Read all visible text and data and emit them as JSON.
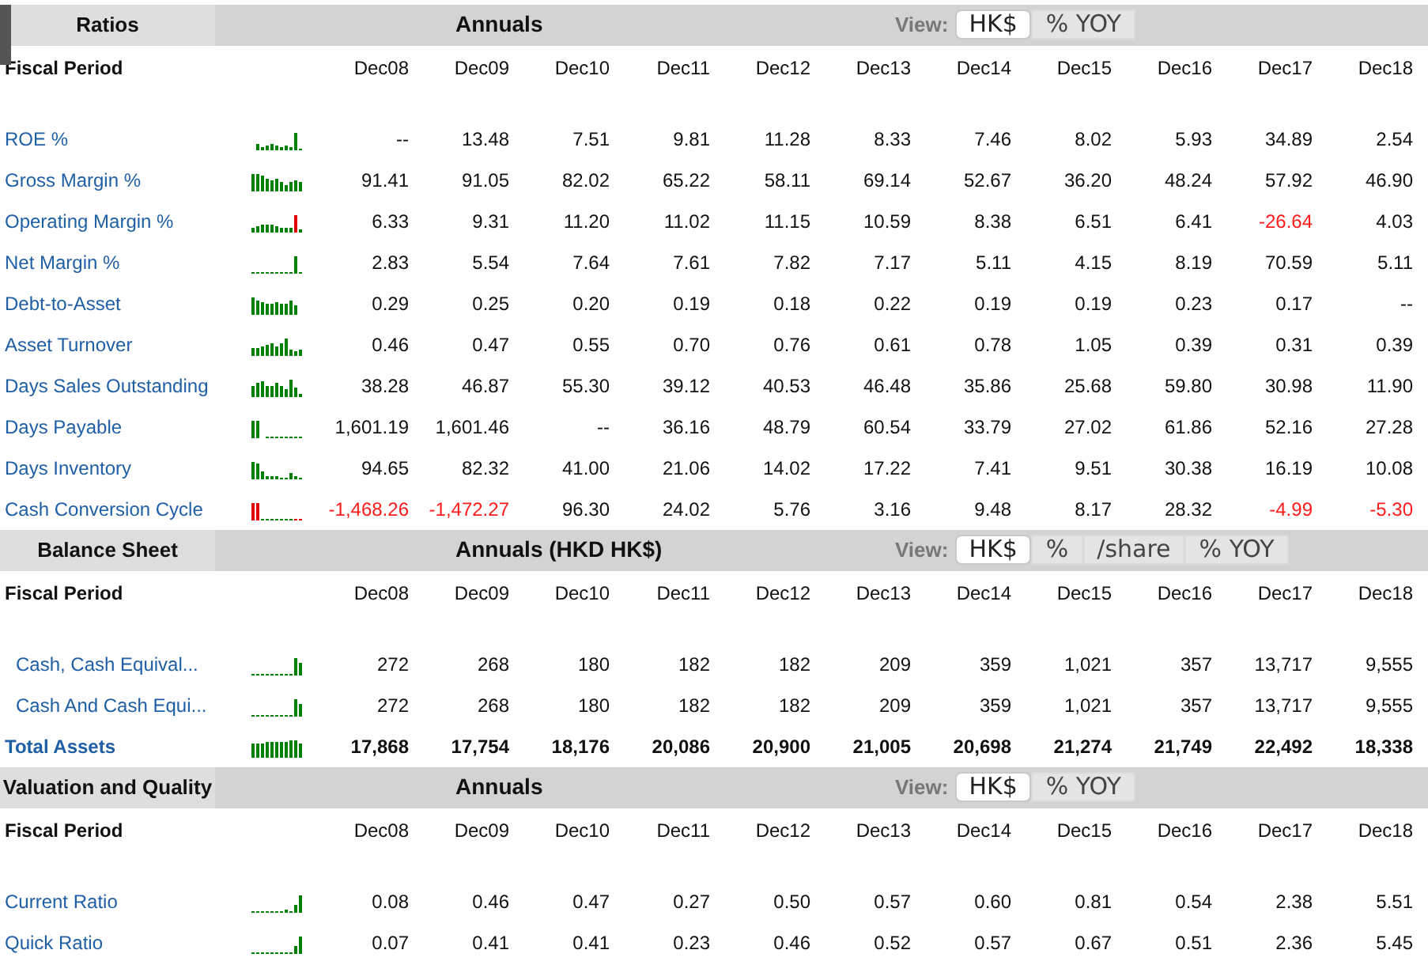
{
  "sections": [
    {
      "title": "Ratios",
      "caption": "Annuals",
      "view_label": "View:",
      "view_options": [
        {
          "label": "HK$",
          "selected": true
        },
        {
          "label": "% YOY",
          "selected": false
        }
      ],
      "period_label": "Fiscal Period",
      "periods": [
        "Dec08",
        "Dec09",
        "Dec10",
        "Dec11",
        "Dec12",
        "Dec13",
        "Dec14",
        "Dec15",
        "Dec16",
        "Dec17",
        "Dec18"
      ],
      "rows": [
        {
          "label": "ROE %",
          "values": [
            "--",
            "13.48",
            "7.51",
            "9.81",
            "11.28",
            "8.33",
            "7.46",
            "8.02",
            "5.93",
            "34.89",
            "2.54"
          ]
        },
        {
          "label": "Gross Margin %",
          "values": [
            "91.41",
            "91.05",
            "82.02",
            "65.22",
            "58.11",
            "69.14",
            "52.67",
            "36.20",
            "48.24",
            "57.92",
            "46.90"
          ]
        },
        {
          "label": "Operating Margin %",
          "values": [
            "6.33",
            "9.31",
            "11.20",
            "11.02",
            "11.15",
            "10.59",
            "8.38",
            "6.51",
            "6.41",
            "-26.64",
            "4.03"
          ],
          "negative": [
            false,
            false,
            false,
            false,
            false,
            false,
            false,
            false,
            false,
            true,
            false
          ]
        },
        {
          "label": "Net Margin %",
          "values": [
            "2.83",
            "5.54",
            "7.64",
            "7.61",
            "7.82",
            "7.17",
            "5.11",
            "4.15",
            "8.19",
            "70.59",
            "5.11"
          ]
        },
        {
          "label": "Debt-to-Asset",
          "values": [
            "0.29",
            "0.25",
            "0.20",
            "0.19",
            "0.18",
            "0.22",
            "0.19",
            "0.19",
            "0.23",
            "0.17",
            "--"
          ]
        },
        {
          "label": "Asset Turnover",
          "values": [
            "0.46",
            "0.47",
            "0.55",
            "0.70",
            "0.76",
            "0.61",
            "0.78",
            "1.05",
            "0.39",
            "0.31",
            "0.39"
          ]
        },
        {
          "label": "Days Sales Outstanding",
          "values": [
            "38.28",
            "46.87",
            "55.30",
            "39.12",
            "40.53",
            "46.48",
            "35.86",
            "25.68",
            "59.80",
            "30.98",
            "11.90"
          ]
        },
        {
          "label": "Days Payable",
          "values": [
            "1,601.19",
            "1,601.46",
            "--",
            "36.16",
            "48.79",
            "60.54",
            "33.79",
            "27.02",
            "61.86",
            "52.16",
            "27.28"
          ]
        },
        {
          "label": "Days Inventory",
          "values": [
            "94.65",
            "82.32",
            "41.00",
            "21.06",
            "14.02",
            "17.22",
            "7.41",
            "9.51",
            "30.38",
            "16.19",
            "10.08"
          ]
        },
        {
          "label": "Cash Conversion Cycle",
          "values": [
            "-1,468.26",
            "-1,472.27",
            "96.30",
            "24.02",
            "5.76",
            "3.16",
            "9.48",
            "8.17",
            "28.32",
            "-4.99",
            "-5.30"
          ],
          "negative": [
            true,
            true,
            false,
            false,
            false,
            false,
            false,
            false,
            false,
            true,
            true
          ]
        }
      ]
    },
    {
      "title": "Balance Sheet",
      "caption": "Annuals (HKD HK$)",
      "view_label": "View:",
      "view_options": [
        {
          "label": "HK$",
          "selected": true
        },
        {
          "label": "%",
          "selected": false
        },
        {
          "label": "/share",
          "selected": false
        },
        {
          "label": "% YOY",
          "selected": false
        }
      ],
      "period_label": "Fiscal Period",
      "periods": [
        "Dec08",
        "Dec09",
        "Dec10",
        "Dec11",
        "Dec12",
        "Dec13",
        "Dec14",
        "Dec15",
        "Dec16",
        "Dec17",
        "Dec18"
      ],
      "rows": [
        {
          "kind": "sub",
          "label": "Cash, Cash Equival...",
          "values": [
            "272",
            "268",
            "180",
            "182",
            "182",
            "209",
            "359",
            "1,021",
            "357",
            "13,717",
            "9,555"
          ]
        },
        {
          "kind": "sub",
          "label": "Cash And Cash Equi...",
          "values": [
            "272",
            "268",
            "180",
            "182",
            "182",
            "209",
            "359",
            "1,021",
            "357",
            "13,717",
            "9,555"
          ]
        },
        {
          "kind": "total",
          "label": "Total Assets",
          "values": [
            "17,868",
            "17,754",
            "18,176",
            "20,086",
            "20,900",
            "21,005",
            "20,698",
            "21,274",
            "21,749",
            "22,492",
            "18,338"
          ]
        }
      ]
    },
    {
      "title": "Valuation and Quality",
      "caption": "Annuals",
      "view_label": "View:",
      "view_options": [
        {
          "label": "HK$",
          "selected": true
        },
        {
          "label": "% YOY",
          "selected": false
        }
      ],
      "period_label": "Fiscal Period",
      "periods": [
        "Dec08",
        "Dec09",
        "Dec10",
        "Dec11",
        "Dec12",
        "Dec13",
        "Dec14",
        "Dec15",
        "Dec16",
        "Dec17",
        "Dec18"
      ],
      "rows": [
        {
          "label": "Current Ratio",
          "values": [
            "0.08",
            "0.46",
            "0.47",
            "0.27",
            "0.50",
            "0.57",
            "0.60",
            "0.81",
            "0.54",
            "2.38",
            "5.51"
          ]
        },
        {
          "label": "Quick Ratio",
          "values": [
            "0.07",
            "0.41",
            "0.41",
            "0.23",
            "0.46",
            "0.52",
            "0.57",
            "0.67",
            "0.51",
            "2.36",
            "5.45"
          ]
        }
      ]
    }
  ]
}
